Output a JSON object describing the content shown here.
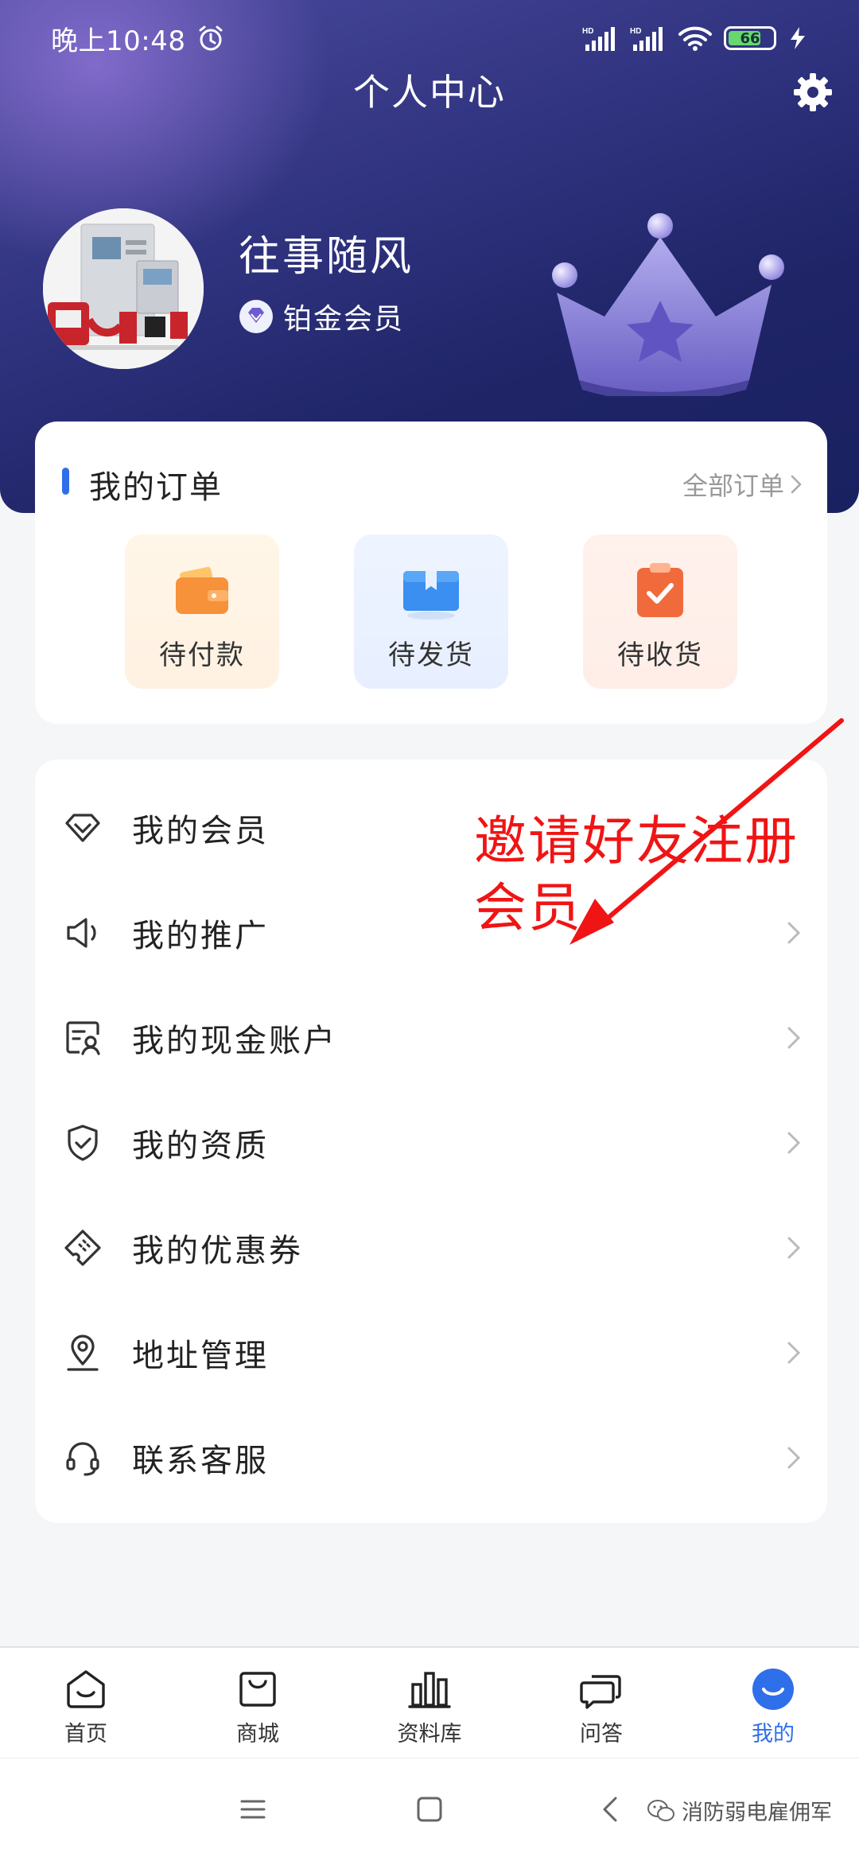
{
  "status_bar": {
    "time": "晚上10:48",
    "network_1": "HD",
    "network_2": "HD",
    "battery": "66"
  },
  "header": {
    "title": "个人中心"
  },
  "profile": {
    "username": "往事随风",
    "member_level": "铂金会员"
  },
  "orders": {
    "title": "我的订单",
    "all_link": "全部订单",
    "tiles": [
      {
        "label": "待付款",
        "icon": "wallet-icon",
        "color": "#f7913a"
      },
      {
        "label": "待发货",
        "icon": "box-icon",
        "color": "#3a8ff0"
      },
      {
        "label": "待收货",
        "icon": "clipboard-check-icon",
        "color": "#f06a3c"
      }
    ]
  },
  "menu": [
    {
      "label": "我的会员",
      "icon": "diamond-icon"
    },
    {
      "label": "我的推广",
      "icon": "speaker-icon"
    },
    {
      "label": "我的现金账户",
      "icon": "account-card-icon"
    },
    {
      "label": "我的资质",
      "icon": "shield-check-icon"
    },
    {
      "label": "我的优惠券",
      "icon": "coupon-icon"
    },
    {
      "label": "地址管理",
      "icon": "location-pin-icon"
    },
    {
      "label": "联系客服",
      "icon": "headset-icon"
    }
  ],
  "annotation": {
    "line1": "邀请好友注册",
    "line2": "会员",
    "color": "#f01414"
  },
  "tab_bar": {
    "tabs": [
      {
        "label": "首页",
        "icon": "home-icon"
      },
      {
        "label": "商城",
        "icon": "shop-bag-icon"
      },
      {
        "label": "资料库",
        "icon": "library-icon"
      },
      {
        "label": "问答",
        "icon": "chat-icon"
      },
      {
        "label": "我的",
        "icon": "profile-icon",
        "active": true
      }
    ]
  },
  "watermark": {
    "text": "消防弱电雇佣军"
  },
  "colors": {
    "accent": "#2f6fe9",
    "hero_dark": "#1e2466",
    "hero_light": "#4a4a9e"
  }
}
